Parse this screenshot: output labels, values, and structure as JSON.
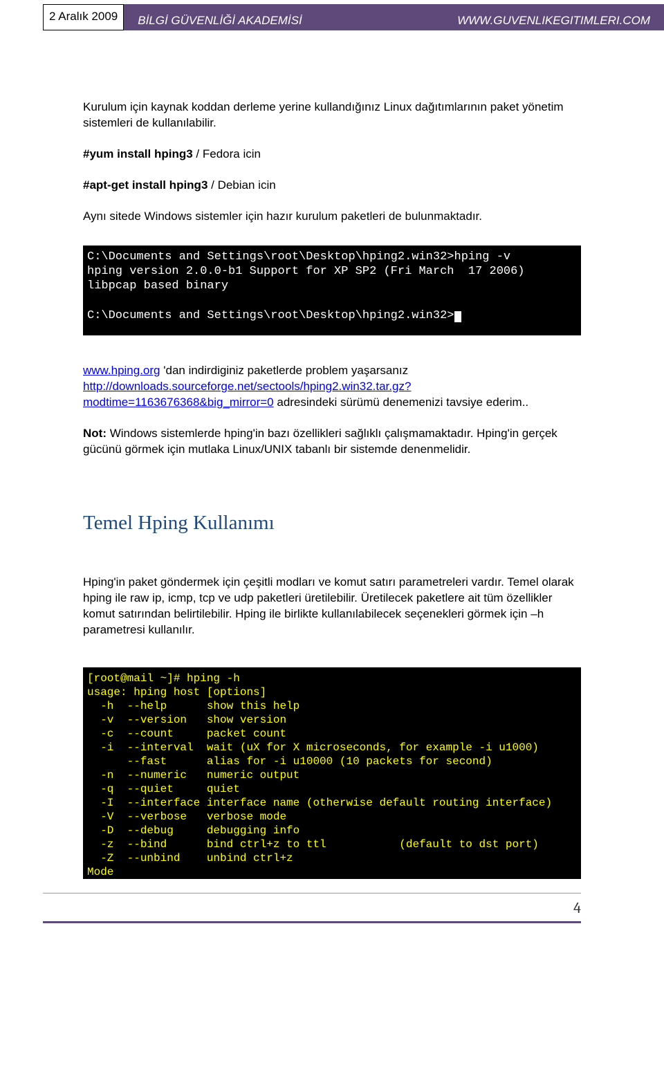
{
  "header": {
    "date": "2 Aralık 2009",
    "title_left": "BİLGİ GÜVENLİĞİ AKADEMİSİ",
    "title_right": "WWW.GUVENLIKEGITIMLERI.COM"
  },
  "para1": "Kurulum için kaynak koddan derleme yerine kullandığınız  Linux dağıtımlarının paket yönetim sistemleri de kullanılabilir.",
  "cmd1_bold": "#yum install hping3",
  "cmd1_rest": "   / Fedora icin",
  "cmd2_bold": "#apt-get install  hping3",
  "cmd2_rest": "   / Debian icin",
  "para2": "Aynı sitede Windows sistemler için hazır kurulum paketleri de bulunmaktadır.",
  "terminal1": {
    "line1": "C:\\Documents and Settings\\root\\Desktop\\hping2.win32>hping -v",
    "line2": "hping version 2.0.0-b1 Support for XP SP2 (Fri March  17 2006)",
    "line3": "libpcap based binary",
    "line4": "C:\\Documents and Settings\\root\\Desktop\\hping2.win32>"
  },
  "para3_link1": "www.hping.org",
  "para3_text1": " 'dan indirdiginiz  paketlerde problem yaşarsanız ",
  "para3_link2": "http://downloads.sourceforge.net/sectools/hping2.win32.tar.gz?modtime=1163676368&big_mirror=0",
  "para3_text2": "  adresindeki sürümü denemenizi tavsiye ederim..",
  "para4_bold": "Not:",
  "para4_text": " Windows sistemlerde hping'in bazı özellikleri sağlıklı çalışmamaktadır. Hping'in gerçek gücünü görmek için mutlaka Linux/UNIX tabanlı bir sistemde denenmelidir.",
  "heading": "Temel Hping Kullanımı",
  "para5": "Hping'in paket göndermek için çeşitli modları ve komut satırı parametreleri vardır. Temel olarak hping ile raw ip, icmp, tcp ve udp paketleri üretilebilir. Üretilecek paketlere ait tüm özellikler komut satırından belirtilebilir. Hping ile birlikte kullanılabilecek seçenekleri görmek için –h parametresi kullanılır.",
  "terminal2": {
    "l1": "[root@mail ~]# hping -h",
    "l2": "usage: hping host [options]",
    "l3": "  -h  --help      show this help",
    "l4": "  -v  --version   show version",
    "l5": "  -c  --count     packet count",
    "l6": "  -i  --interval  wait (uX for X microseconds, for example -i u1000)",
    "l7": "      --fast      alias for -i u10000 (10 packets for second)",
    "l8": "  -n  --numeric   numeric output",
    "l9": "  -q  --quiet     quiet",
    "l10": "  -I  --interface interface name (otherwise default routing interface)",
    "l11": "  -V  --verbose   verbose mode",
    "l12": "  -D  --debug     debugging info",
    "l13": "  -z  --bind      bind ctrl+z to ttl           (default to dst port)",
    "l14": "  -Z  --unbind    unbind ctrl+z",
    "l15": "Mode"
  },
  "pageNumber": "4"
}
